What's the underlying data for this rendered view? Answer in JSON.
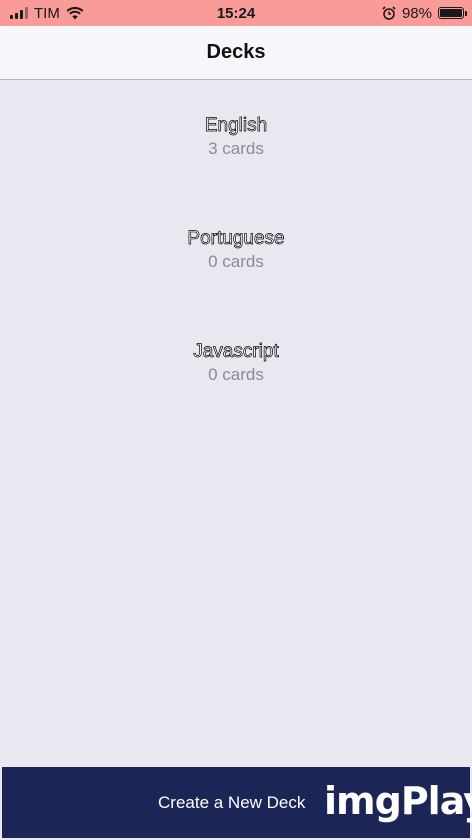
{
  "status_bar": {
    "carrier": "TIM",
    "time": "15:24",
    "battery_percent_text": "98%",
    "battery_level": 0.98,
    "icons": [
      "signal-icon",
      "wifi-icon",
      "alarm-icon",
      "battery-icon"
    ]
  },
  "nav": {
    "title": "Decks"
  },
  "decks": [
    {
      "name": "English",
      "count": "3 cards"
    },
    {
      "name": "Portuguese",
      "count": "0 cards"
    },
    {
      "name": "Javascript",
      "count": "0 cards"
    }
  ],
  "bottom_bar": {
    "create_label": "Create a New Deck",
    "watermark": "imgPlay"
  },
  "colors": {
    "status_bar_bg": "#f99b98",
    "background": "#e9e8f1",
    "bottom_bar_bg": "#1b2656"
  }
}
